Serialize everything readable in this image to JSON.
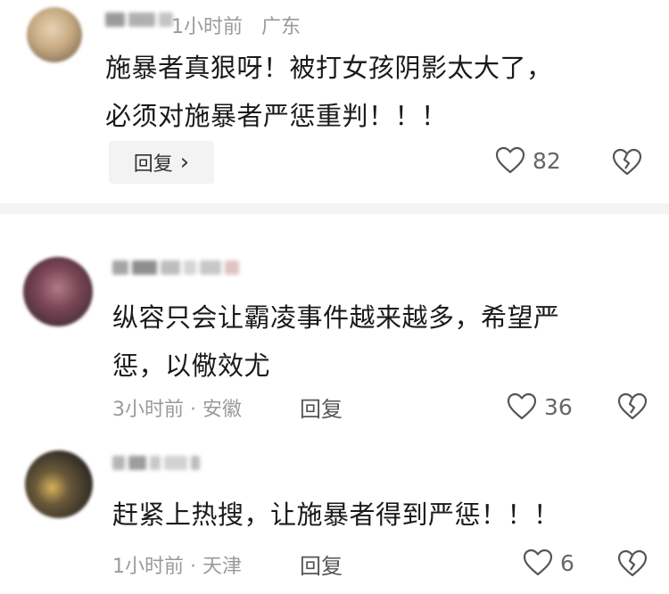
{
  "comments": [
    {
      "time": "1小时前",
      "location": "广东",
      "lines": [
        "施暴者真狠呀！被打女孩阴影太大了，",
        "必须对施暴者严惩重判！！！"
      ],
      "reply_label": "回复",
      "reply_chevron": "›",
      "likes": "82",
      "avatar_color": "#cdb79a"
    },
    {
      "time": "3小时前",
      "separator": "·",
      "location": "安徽",
      "lines": [
        "纵容只会让霸凌事件越来越多，希望严",
        "惩，以儆效尤"
      ],
      "reply_label": "回复",
      "likes": "36",
      "avatar_color": "#7a4a5a"
    },
    {
      "time": "1小时前",
      "separator": "·",
      "location": "天津",
      "lines": [
        "赶紧上热搜，让施暴者得到严惩！！！"
      ],
      "reply_label": "回复",
      "likes": "6",
      "avatar_color": "#3a3530"
    }
  ],
  "icons": {
    "like": "heart-outline-icon",
    "dislike": "broken-heart-icon"
  },
  "colors": {
    "text": "#1a1a1a",
    "meta": "#9a9a9a",
    "icon": "#555555",
    "divider": "#f4f4f4"
  }
}
